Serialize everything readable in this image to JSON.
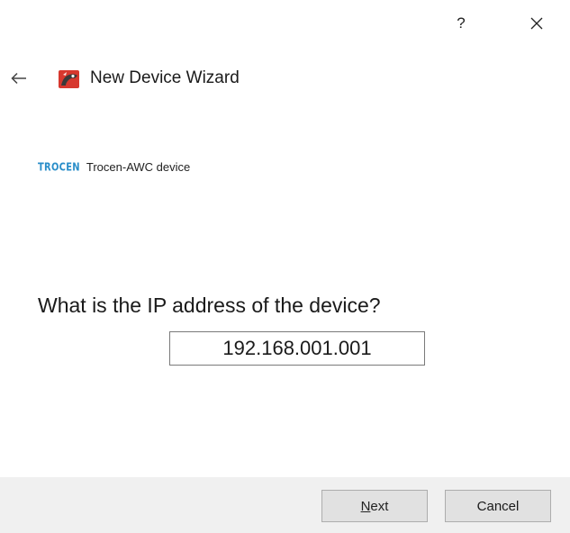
{
  "window": {
    "help_label": "?",
    "close_icon": "close-icon"
  },
  "header": {
    "back_icon": "arrow-left-icon",
    "app_icon": "wizard-app-icon",
    "title": "New Device Wizard"
  },
  "device": {
    "brand_logo_text": "TROCEN",
    "name": "Trocen-AWC device",
    "brand_color": "#2a8ec9"
  },
  "question": {
    "text": "What is the IP address of the device?",
    "ip_value": "192.168.001.001"
  },
  "footer": {
    "next_mnemonic": "N",
    "next_rest": "ext",
    "cancel_label": "Cancel"
  }
}
